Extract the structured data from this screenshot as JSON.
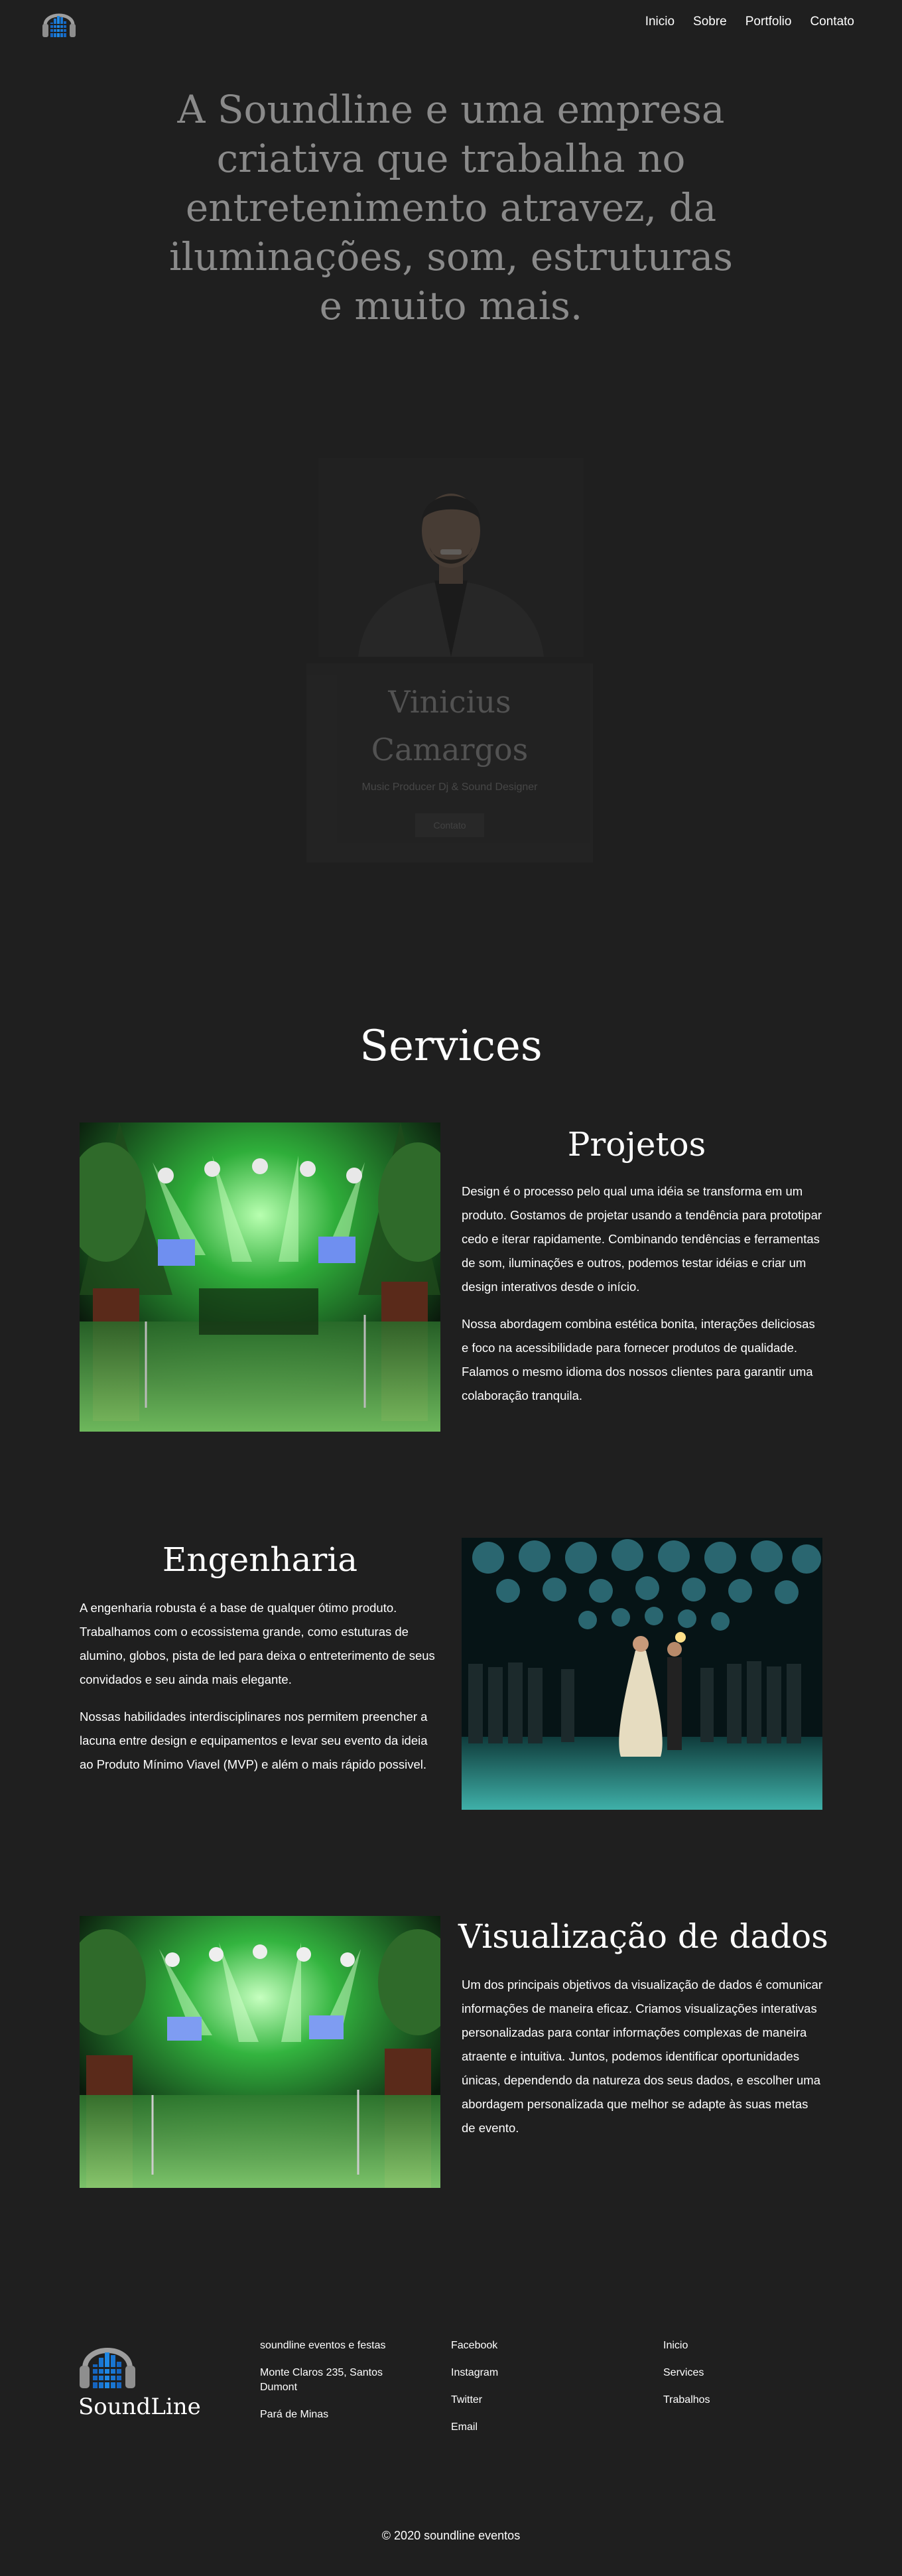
{
  "nav": {
    "brand_icon": "headphones-equalizer-logo",
    "links": [
      "Inicio",
      "Sobre",
      "Portfolio",
      "Contato"
    ]
  },
  "hero": {
    "text": "A Soundline e uma empresa criativa que trabalha no entretenimento atravez, da iluminações, som, estruturas e muito mais."
  },
  "profile": {
    "name": "Vinicius Camargos",
    "role": "Music Producer Dj & Sound Designer",
    "button_label": "Contato"
  },
  "services": {
    "title": "Services",
    "items": [
      {
        "title": "Projetos",
        "paragraphs": [
          "Design é o processo pelo qual uma idéia se transforma em um produto. Gostamos de projetar usando a tendência para prototipar cedo e iterar rapidamente. Combinando tendências e ferramentas de som, iluminações e outros, podemos testar idéias e criar um design interativos desde o início.",
          "Nossa abordagem combina estética bonita, interações deliciosas e foco na acessibilidade para fornecer produtos de qualidade. Falamos o mesmo idioma dos nossos clientes para garantir uma colaboração tranquila."
        ],
        "image": "event-venue-green-lights"
      },
      {
        "title": "Engenharia",
        "paragraphs": [
          "A engenharia robusta é a base de qualquer ótimo produto. Trabalhamos com o ecossistema grande, como estuturas de alumino, globos, pista de led para deixa o entreterimento de seus convidados e seu ainda mais elegante.",
          "Nossas habilidades interdisciplinares nos permitem preencher a lacuna entre design e equipamentos e levar seu evento da ideia ao Produto Mínimo Viavel (MVP) e além o mais rápido possivel."
        ],
        "image": "party-mirror-balls-crowd"
      },
      {
        "title": "Visualização de dados",
        "paragraphs": [
          "Um dos principais objetivos da visualização de dados é comunicar informações de maneira eficaz. Criamos visualizações interativas personalizadas para contar informações complexas de maneira atraente e intuitiva. Juntos, podemos identificar oportunidades únicas, dependendo da natureza dos seus dados, e escolher uma abordagem personalizada que melhor se adapte às suas metas de evento."
        ],
        "image": "event-venue-green-lights"
      }
    ]
  },
  "footer": {
    "brand": "SoundLine",
    "contact": [
      "soundline eventos e festas",
      "Monte Claros 235, Santos Dumont",
      "Pará de Minas"
    ],
    "social": [
      "Facebook",
      "Instagram",
      "Twitter",
      "Email"
    ],
    "links": [
      "Inicio",
      "Services",
      "Trabalhos"
    ],
    "copyright": "© 2020 soundline eventos"
  },
  "colors": {
    "background": "#1f1f1f",
    "hero_text": "#8a8a8a",
    "logo_blue": "#1565c0"
  }
}
